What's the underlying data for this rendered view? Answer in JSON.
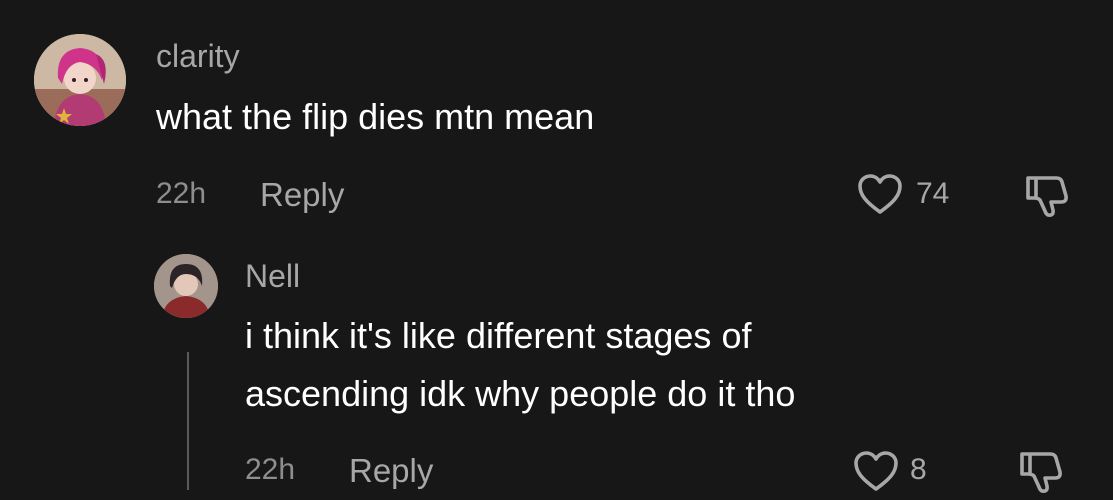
{
  "comments": [
    {
      "username": "clarity",
      "text": "what the flip dies mtn mean",
      "time": "22h",
      "reply_label": "Reply",
      "likes": "74",
      "avatar_icon": "avatar-pink-hair",
      "accent": "#c0337a"
    },
    {
      "username": "Nell",
      "text_lines": [
        "i think it's like different stages of",
        "ascending idk why people do it tho"
      ],
      "time": "22h",
      "reply_label": "Reply",
      "likes": "8",
      "avatar_icon": "avatar-dark-hair",
      "accent": "#8a2a2a"
    }
  ],
  "icons": {
    "like": "heart-outline-icon",
    "dislike": "thumbs-down-icon"
  },
  "colors": {
    "background": "#171717",
    "primary_text": "#ffffff",
    "secondary_text": "#a7a7a7"
  }
}
